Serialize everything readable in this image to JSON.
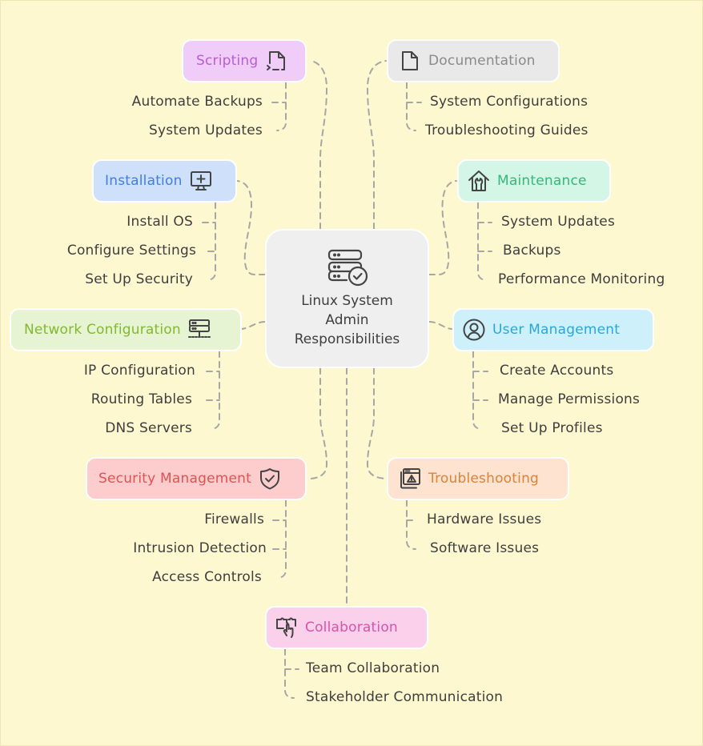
{
  "center": {
    "title": "Linux System\nAdmin\nResponsibilities",
    "icon": "server-check-icon"
  },
  "colors": {
    "background": "#fef8d0",
    "connector": "#a6a6a6",
    "text": "#3e3e3e"
  },
  "branches": [
    {
      "id": "scripting",
      "label": "Scripting",
      "icon": "file-terminal-icon",
      "bg": "#f0cdf9",
      "fg": "#b65ed4",
      "children": [
        "Automate Backups",
        "System Updates"
      ]
    },
    {
      "id": "documentation",
      "label": "Documentation",
      "icon": "file-icon",
      "bg": "#e9e9e9",
      "fg": "#8a8a8a",
      "children": [
        "System Configurations",
        "Troubleshooting Guides"
      ]
    },
    {
      "id": "installation",
      "label": "Installation",
      "icon": "monitor-plus-icon",
      "bg": "#cfe0fb",
      "fg": "#3f7fdf",
      "children": [
        "Install OS",
        "Configure Settings",
        "Set Up Security"
      ]
    },
    {
      "id": "maintenance",
      "label": "Maintenance",
      "icon": "house-wrench-icon",
      "bg": "#d3f6e6",
      "fg": "#37b877",
      "children": [
        "System Updates",
        "Backups",
        "Performance Monitoring"
      ]
    },
    {
      "id": "network",
      "label": "Network Configuration",
      "icon": "network-server-icon",
      "bg": "#e6f4d3",
      "fg": "#82b92f",
      "children": [
        "IP Configuration",
        "Routing Tables",
        "DNS Servers"
      ]
    },
    {
      "id": "user",
      "label": "User Management",
      "icon": "user-circle-icon",
      "bg": "#cdf0fb",
      "fg": "#2aa7d6",
      "children": [
        "Create Accounts",
        "Manage Permissions",
        "Set Up Profiles"
      ]
    },
    {
      "id": "security",
      "label": "Security Management",
      "icon": "shield-check-icon",
      "bg": "#fdcdcd",
      "fg": "#e05252",
      "children": [
        "Firewalls",
        "Intrusion Detection",
        "Access Controls"
      ]
    },
    {
      "id": "troubleshooting",
      "label": "Troubleshooting",
      "icon": "window-warning-icon",
      "bg": "#fde3d0",
      "fg": "#de8237",
      "children": [
        "Hardware Issues",
        "Software Issues"
      ]
    },
    {
      "id": "collaboration",
      "label": "Collaboration",
      "icon": "puzzle-hand-icon",
      "bg": "#fbd0ea",
      "fg": "#d953a8",
      "children": [
        "Team Collaboration",
        "Stakeholder Communication"
      ]
    }
  ]
}
